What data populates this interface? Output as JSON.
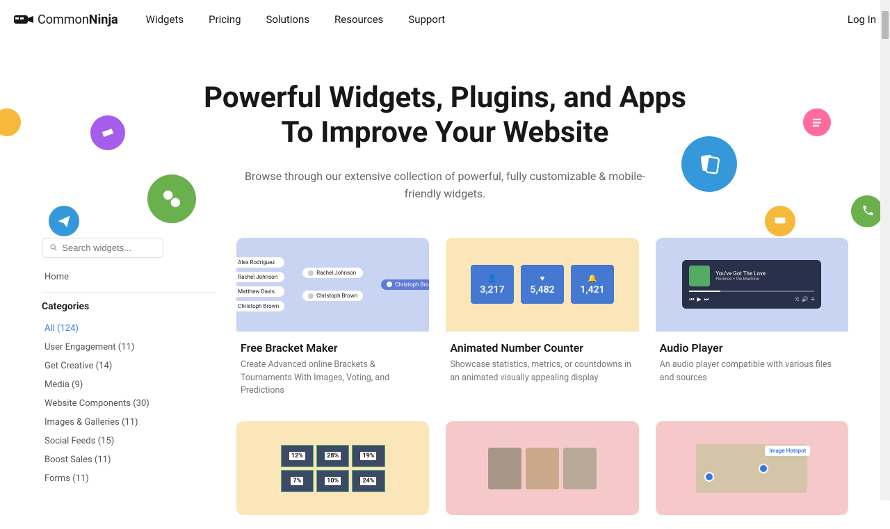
{
  "brand_first": "Common",
  "brand_second": "Ninja",
  "nav": {
    "widgets": "Widgets",
    "pricing": "Pricing",
    "solutions": "Solutions",
    "resources": "Resources",
    "support": "Support"
  },
  "login": "Log In",
  "hero_line1": "Powerful Widgets, Plugins, and Apps",
  "hero_line2": "To Improve Your Website",
  "hero_sub": "Browse through our extensive collection of powerful, fully customizable & mobile-friendly widgets.",
  "search_placeholder": "Search widgets...",
  "home": "Home",
  "categories_heading": "Categories",
  "categories": [
    "All (124)",
    "User Engagement (11)",
    "Get Creative (14)",
    "Media (9)",
    "Website Components (30)",
    "Images & Galleries (11)",
    "Social Feeds (15)",
    "Boost Sales (11)",
    "Forms (11)"
  ],
  "cards": [
    {
      "title": "Free Bracket Maker",
      "desc": "Create Advanced online Brackets & Tournaments With Images, Voting, and Predictions"
    },
    {
      "title": "Animated Number Counter",
      "desc": "Showcase statistics, metrics, or countdowns in an animated visually appealing display"
    },
    {
      "title": "Audio Player",
      "desc": "An audio player compatible with various files and sources"
    }
  ],
  "bracket_names": [
    "Alex Rodriguez",
    "Rachel Johnson",
    "Matthew Davis",
    "Christoph Brown",
    "Rachel Johnson",
    "Christoph Brown",
    "Christoph Brown"
  ],
  "counter_vals": [
    "3,217",
    "5,482",
    "1,421"
  ],
  "audio_title": "You've Got The Love",
  "audio_sub": "Florence + the Machine",
  "hotspot_label": "Image Hotspot",
  "percent_vals": [
    "12%",
    "28%",
    "19%",
    "7%",
    "10%",
    "24%"
  ]
}
